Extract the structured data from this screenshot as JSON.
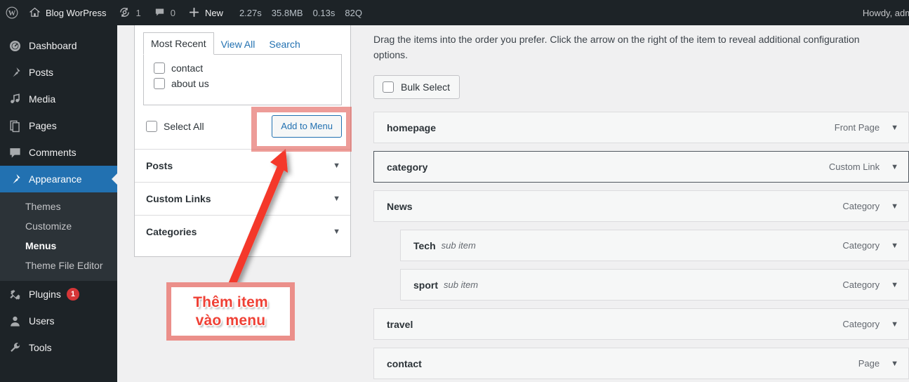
{
  "adminbar": {
    "logo_icon": "wordpress-logo-icon",
    "home_icon": "home-icon",
    "site_name": "Blog WorPress",
    "updates_icon": "updates-icon",
    "updates_count": "1",
    "comments_icon": "comment-bubble-icon",
    "comments_count": "0",
    "new_icon": "plus-icon",
    "new_label": "New",
    "perf": {
      "time": "2.27s",
      "memory": "35.8MB",
      "query_time": "0.13s",
      "queries": "82Q"
    },
    "howdy": "Howdy, admi"
  },
  "sidebar": {
    "items": [
      {
        "label": "Dashboard",
        "icon": "dashboard-icon",
        "current": false
      },
      {
        "label": "Posts",
        "icon": "pin-icon",
        "current": false
      },
      {
        "label": "Media",
        "icon": "media-icon",
        "current": false
      },
      {
        "label": "Pages",
        "icon": "pages-icon",
        "current": false
      },
      {
        "label": "Comments",
        "icon": "comment-icon",
        "current": false
      },
      {
        "label": "Appearance",
        "icon": "brush-icon",
        "current": true
      }
    ],
    "appearance_submenu": [
      {
        "label": "Themes",
        "active": false
      },
      {
        "label": "Customize",
        "active": false
      },
      {
        "label": "Menus",
        "active": true
      },
      {
        "label": "Theme File Editor",
        "active": false
      }
    ],
    "items_after": [
      {
        "label": "Plugins",
        "icon": "plug-icon",
        "badge": "1"
      },
      {
        "label": "Users",
        "icon": "user-icon",
        "badge": ""
      },
      {
        "label": "Tools",
        "icon": "wrench-icon",
        "badge": ""
      }
    ]
  },
  "left_panel": {
    "tabs": [
      {
        "label": "Most Recent",
        "active": true
      },
      {
        "label": "View All",
        "active": false
      },
      {
        "label": "Search",
        "active": false
      }
    ],
    "items": [
      {
        "label": "contact",
        "checked": false
      },
      {
        "label": "about us",
        "checked": false
      }
    ],
    "select_all_label": "Select All",
    "add_to_menu_label": "Add to Menu",
    "accordions": [
      {
        "label": "Posts",
        "caret": "▼"
      },
      {
        "label": "Custom Links",
        "caret": "▼"
      },
      {
        "label": "Categories",
        "caret": "▼"
      }
    ]
  },
  "right_panel": {
    "hint": "Drag the items into the order you prefer. Click the arrow on the right of the item to reveal additional configuration options.",
    "bulk_select_label": "Bulk Select",
    "menu_items": [
      {
        "title": "homepage",
        "sub": "",
        "type": "Front Page",
        "nested": false,
        "selected": false,
        "caret": "▼"
      },
      {
        "title": "category",
        "sub": "",
        "type": "Custom Link",
        "nested": false,
        "selected": true,
        "caret": "▼"
      },
      {
        "title": "News",
        "sub": "",
        "type": "Category",
        "nested": false,
        "selected": false,
        "caret": "▼"
      },
      {
        "title": "Tech",
        "sub": "sub item",
        "type": "Category",
        "nested": true,
        "selected": false,
        "caret": "▼"
      },
      {
        "title": "sport",
        "sub": "sub item",
        "type": "Category",
        "nested": true,
        "selected": false,
        "caret": "▼"
      },
      {
        "title": "travel",
        "sub": "",
        "type": "Category",
        "nested": false,
        "selected": false,
        "caret": "▼"
      },
      {
        "title": "contact",
        "sub": "",
        "type": "Page",
        "nested": false,
        "selected": false,
        "caret": "▼"
      }
    ]
  },
  "annotation": {
    "line1": "Thêm item",
    "line2": "vào menu",
    "accent_color": "#ef4136",
    "box_border_color": "#e26058"
  }
}
